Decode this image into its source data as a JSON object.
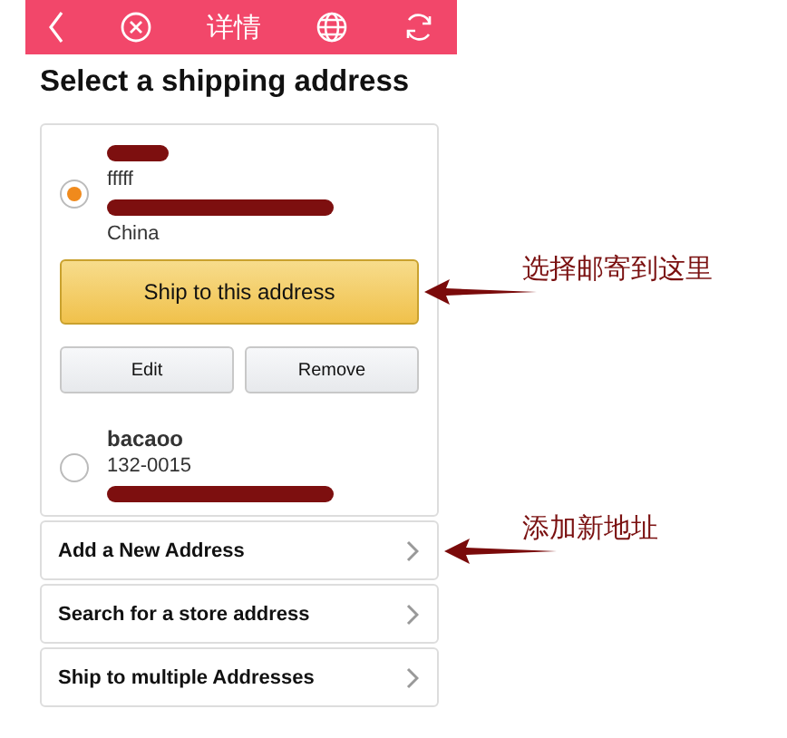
{
  "header": {
    "title": "详情"
  },
  "heading": "Select a shipping address",
  "addresses": [
    {
      "lines": [
        {
          "kind": "blot"
        },
        {
          "kind": "text",
          "text": "fffff"
        },
        {
          "kind": "redaction"
        },
        {
          "kind": "text",
          "text": "China"
        }
      ],
      "selected": true
    },
    {
      "lines": [
        {
          "kind": "name",
          "text": "bacaoo"
        },
        {
          "kind": "text",
          "text": "132-0015"
        },
        {
          "kind": "redaction"
        }
      ],
      "selected": false
    }
  ],
  "primary_button": {
    "label": "Ship to this address",
    "annotation": "选择邮寄到这里"
  },
  "secondary_buttons": [
    "Edit",
    "Remove"
  ],
  "links": [
    {
      "label": "Add a New Address",
      "annotation": "添加新地址"
    },
    {
      "label": "Search for a store address"
    },
    {
      "label": "Ship to multiple Addresses"
    }
  ]
}
